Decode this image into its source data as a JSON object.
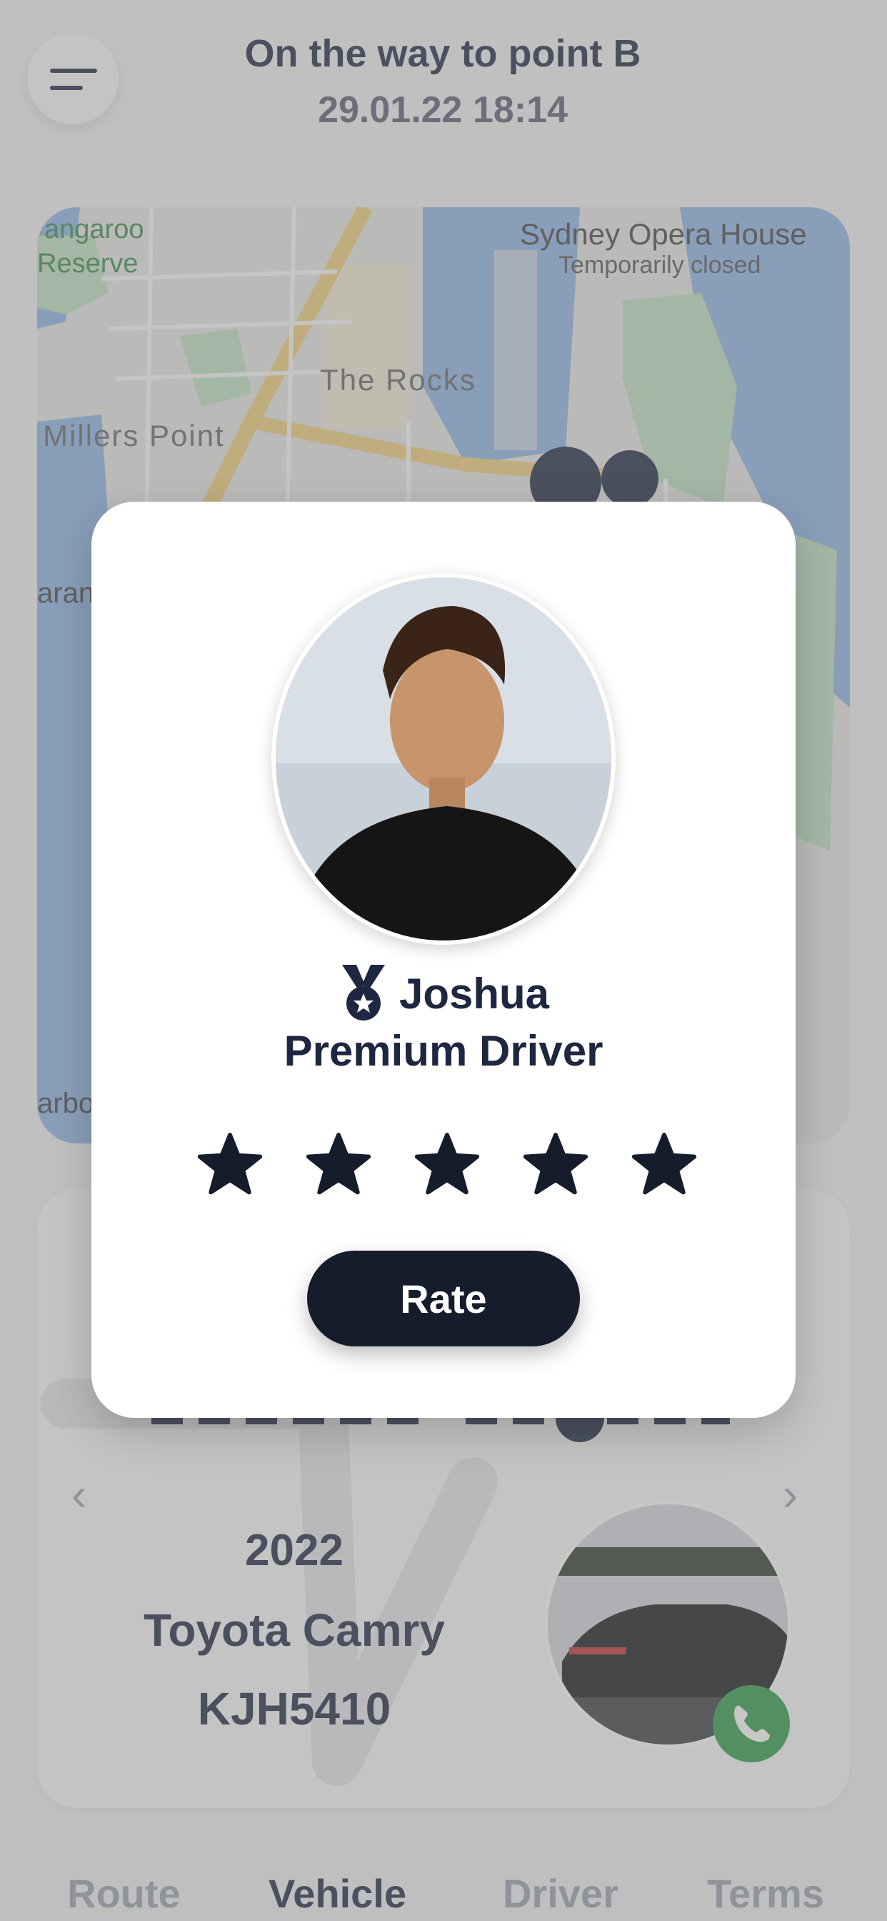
{
  "header": {
    "title": "On the way to point B",
    "datetime": "29.01.22 18:14"
  },
  "map": {
    "labels": {
      "kangaroo": "angaroo",
      "reserve": "Reserve",
      "opera_house": "Sydney Opera House",
      "opera_status": "Temporarily closed",
      "the_rocks": "The Rocks",
      "millers_point": "Millers Point",
      "barangaroo": "aran",
      "harbour": "arbo"
    }
  },
  "vehicle": {
    "year": "2022",
    "model": "Toyota Camry",
    "plate": "KJH5410"
  },
  "tabs": {
    "route": "Route",
    "vehicle": "Vehicle",
    "driver": "Driver",
    "terms": "Terms",
    "active": "Vehicle"
  },
  "driver_modal": {
    "name": "Joshua",
    "title": "Premium Driver",
    "rating_stars": 5,
    "rate_label": "Rate"
  },
  "colors": {
    "primary": "#1e2740",
    "button": "#151c2c",
    "call": "#2e9a46"
  },
  "icons": {
    "menu": "menu-icon",
    "medal": "medal-icon",
    "star": "star-icon",
    "phone": "phone-icon",
    "prev": "chevron-left-icon",
    "next": "chevron-right-icon"
  }
}
